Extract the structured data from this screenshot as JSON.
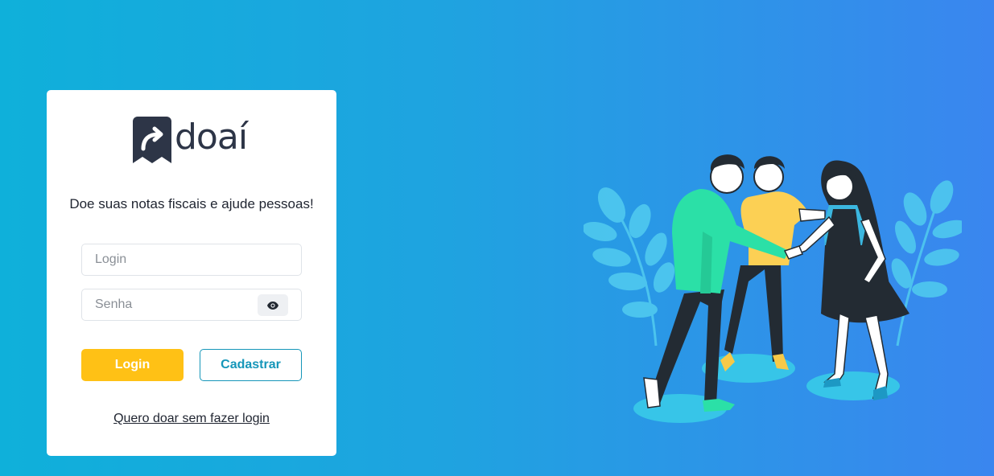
{
  "app": {
    "brand_name": "doaí",
    "tagline": "Doe suas notas fiscais e ajude pessoas!"
  },
  "form": {
    "login_placeholder": "Login",
    "login_value": "",
    "password_placeholder": "Senha",
    "password_value": "",
    "show_password_icon": "eye-icon",
    "login_button_label": "Login",
    "register_button_label": "Cadastrar",
    "guest_link_label": "Quero doar sem fazer login"
  },
  "colors": {
    "background_start": "#0fb0da",
    "background_end": "#3a86ef",
    "primary_button": "#ffc115",
    "secondary_accent": "#1596b9",
    "brand_dark": "#2d3547"
  },
  "illustration": {
    "icon": "team-hands-together-illustration"
  }
}
